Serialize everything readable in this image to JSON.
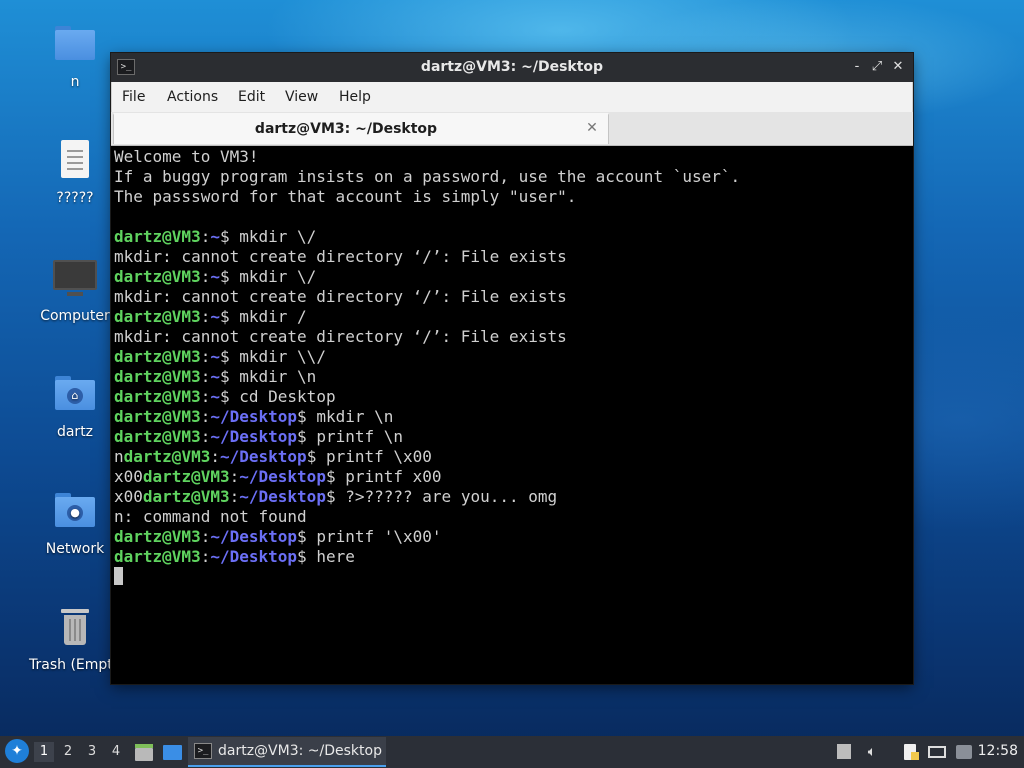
{
  "desktop": {
    "icons": [
      {
        "label": "n",
        "icon": "folder-icon"
      },
      {
        "label": "?????",
        "icon": "text-file-icon"
      },
      {
        "label": "Computer",
        "icon": "computer-icon"
      },
      {
        "label": "dartz",
        "icon": "home-folder-icon"
      },
      {
        "label": "Network",
        "icon": "network-folder-icon"
      },
      {
        "label": "Trash (Empty)",
        "icon": "trash-icon"
      }
    ]
  },
  "window": {
    "title": "dartz@VM3: ~/Desktop",
    "controls": {
      "minimize": "-",
      "maximize": "⤢",
      "close": "✕"
    },
    "menu": [
      "File",
      "Actions",
      "Edit",
      "View",
      "Help"
    ],
    "tab": {
      "label": "dartz@VM3: ~/Desktop",
      "close": "✕"
    }
  },
  "terminal": {
    "lines": [
      [
        [
          "t",
          "Welcome to VM3!"
        ]
      ],
      [
        [
          "t",
          "If a buggy program insists on a password, use the account `user`."
        ]
      ],
      [
        [
          "t",
          "The passsword for that account is simply \"user\"."
        ]
      ],
      [
        [
          "t",
          ""
        ]
      ],
      [
        [
          "u",
          "dartz@VM3"
        ],
        [
          "t",
          ":"
        ],
        [
          "p",
          "~"
        ],
        [
          "t",
          "$ mkdir \\/"
        ]
      ],
      [
        [
          "t",
          "mkdir: cannot create directory ‘/’: File exists"
        ]
      ],
      [
        [
          "u",
          "dartz@VM3"
        ],
        [
          "t",
          ":"
        ],
        [
          "p",
          "~"
        ],
        [
          "t",
          "$ mkdir \\/"
        ]
      ],
      [
        [
          "t",
          "mkdir: cannot create directory ‘/’: File exists"
        ]
      ],
      [
        [
          "u",
          "dartz@VM3"
        ],
        [
          "t",
          ":"
        ],
        [
          "p",
          "~"
        ],
        [
          "t",
          "$ mkdir /"
        ]
      ],
      [
        [
          "t",
          "mkdir: cannot create directory ‘/’: File exists"
        ]
      ],
      [
        [
          "u",
          "dartz@VM3"
        ],
        [
          "t",
          ":"
        ],
        [
          "p",
          "~"
        ],
        [
          "t",
          "$ mkdir \\\\/"
        ]
      ],
      [
        [
          "u",
          "dartz@VM3"
        ],
        [
          "t",
          ":"
        ],
        [
          "p",
          "~"
        ],
        [
          "t",
          "$ mkdir \\n"
        ]
      ],
      [
        [
          "u",
          "dartz@VM3"
        ],
        [
          "t",
          ":"
        ],
        [
          "p",
          "~"
        ],
        [
          "t",
          "$ cd Desktop"
        ]
      ],
      [
        [
          "u",
          "dartz@VM3"
        ],
        [
          "t",
          ":"
        ],
        [
          "p",
          "~/Desktop"
        ],
        [
          "t",
          "$ mkdir \\n"
        ]
      ],
      [
        [
          "u",
          "dartz@VM3"
        ],
        [
          "t",
          ":"
        ],
        [
          "p",
          "~/Desktop"
        ],
        [
          "t",
          "$ printf \\n"
        ]
      ],
      [
        [
          "t",
          "n"
        ],
        [
          "u",
          "dartz@VM3"
        ],
        [
          "t",
          ":"
        ],
        [
          "p",
          "~/Desktop"
        ],
        [
          "t",
          "$ printf \\x00"
        ]
      ],
      [
        [
          "t",
          "x00"
        ],
        [
          "u",
          "dartz@VM3"
        ],
        [
          "t",
          ":"
        ],
        [
          "p",
          "~/Desktop"
        ],
        [
          "t",
          "$ printf x00"
        ]
      ],
      [
        [
          "t",
          "x00"
        ],
        [
          "u",
          "dartz@VM3"
        ],
        [
          "t",
          ":"
        ],
        [
          "p",
          "~/Desktop"
        ],
        [
          "t",
          "$ ?>????? are you... omg"
        ]
      ],
      [
        [
          "t",
          "n: command not found"
        ]
      ],
      [
        [
          "u",
          "dartz@VM3"
        ],
        [
          "t",
          ":"
        ],
        [
          "p",
          "~/Desktop"
        ],
        [
          "t",
          "$ printf '\\x00'"
        ]
      ],
      [
        [
          "u",
          "dartz@VM3"
        ],
        [
          "t",
          ":"
        ],
        [
          "p",
          "~/Desktop"
        ],
        [
          "t",
          "$ here"
        ]
      ]
    ]
  },
  "taskbar": {
    "workspaces": [
      "1",
      "2",
      "3",
      "4"
    ],
    "active_workspace": "1",
    "task_label": "dartz@VM3: ~/Desktop",
    "clock": "12:58",
    "tray_icons": [
      "package-update-icon",
      "volume-icon",
      "clipboard-icon",
      "network-icon",
      "notifications-icon"
    ]
  },
  "colors": {
    "prompt_user": "#5fd35f",
    "prompt_path": "#6b6ff5",
    "terminal_text": "#d0d0d0",
    "taskbar_bg": "#2b2f37"
  }
}
